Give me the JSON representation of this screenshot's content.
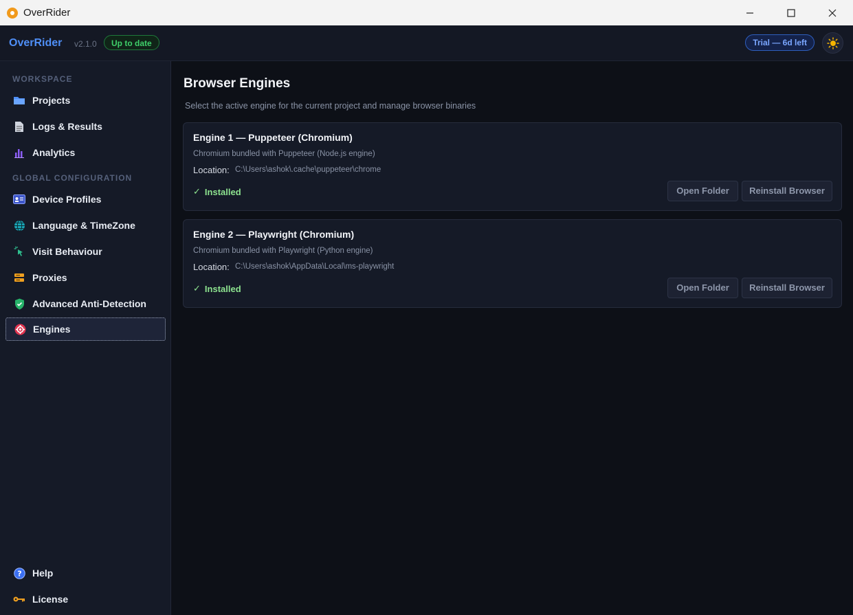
{
  "window": {
    "title": "OverRider",
    "minimize": "—",
    "maximize": "☐",
    "close": "✕"
  },
  "header": {
    "brand": "OverRider",
    "version": "v2.1.0",
    "update_status": "Up to date",
    "trial": "Trial — 6d left",
    "theme_icon": "sun-icon"
  },
  "sidebar": {
    "sections": [
      {
        "label": "WORKSPACE"
      },
      {
        "label": "GLOBAL CONFIGURATION"
      }
    ],
    "items": [
      {
        "label": "Projects",
        "icon": "folder-icon"
      },
      {
        "label": "Logs & Results",
        "icon": "document-icon"
      },
      {
        "label": "Analytics",
        "icon": "bar-chart-icon"
      },
      {
        "label": "Device Profiles",
        "icon": "id-card-icon"
      },
      {
        "label": "Language & TimeZone",
        "icon": "globe-icon"
      },
      {
        "label": "Visit Behaviour",
        "icon": "sparkle-cursor-icon"
      },
      {
        "label": "Proxies",
        "icon": "server-icon"
      },
      {
        "label": "Advanced Anti-Detection",
        "icon": "shield-icon"
      },
      {
        "label": "Engines",
        "icon": "gear-icon",
        "active": true
      }
    ],
    "footer": [
      {
        "label": "Help",
        "icon": "help-icon"
      },
      {
        "label": "License",
        "icon": "key-icon"
      }
    ]
  },
  "main": {
    "title": "Browser Engines",
    "subtitle": "Select the active engine for the current project and manage browser binaries",
    "engines": [
      {
        "title": "Engine 1 — Puppeteer (Chromium)",
        "description": "Chromium bundled with Puppeteer (Node.js engine)",
        "location_label": "Location:",
        "location": "C:\\Users\\ashok\\.cache\\puppeteer\\chrome",
        "status": "Installed",
        "open_label": "Open Folder",
        "reinstall_label": "Reinstall Browser"
      },
      {
        "title": "Engine 2 — Playwright (Chromium)",
        "description": "Chromium bundled with Playwright (Python engine)",
        "location_label": "Location:",
        "location": "C:\\Users\\ashok\\AppData\\Local\\ms-playwright",
        "status": "Installed",
        "open_label": "Open Folder",
        "reinstall_label": "Reinstall Browser"
      }
    ]
  },
  "colors": {
    "accent": "#4f8ff7",
    "success": "#3fcf6a",
    "installed": "#8de38f",
    "bg": "#0d1017",
    "panel": "#151a27"
  }
}
